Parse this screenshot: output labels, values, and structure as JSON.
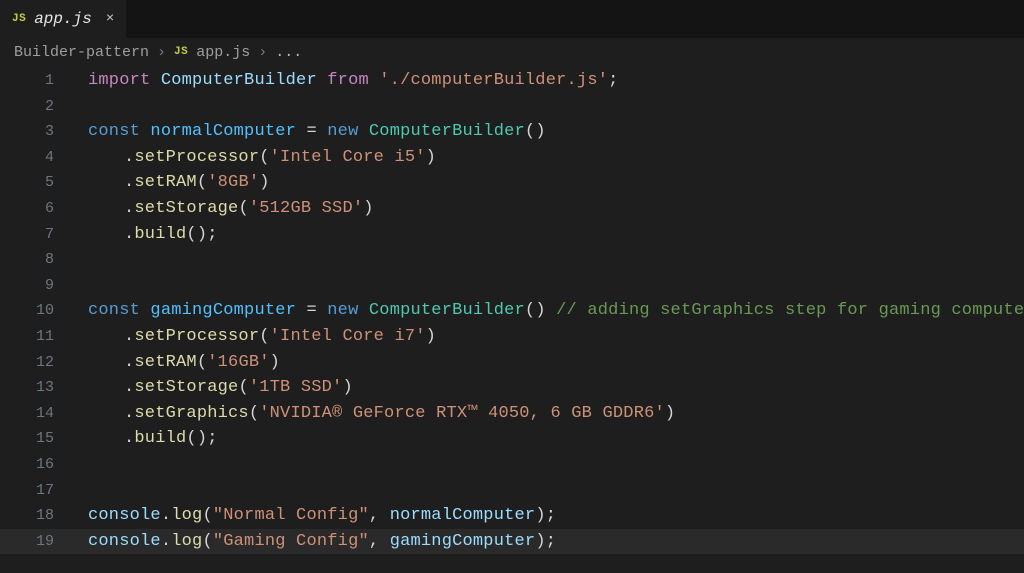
{
  "tab": {
    "lang_badge": "JS",
    "filename": "app.js",
    "close_glyph": "×"
  },
  "breadcrumb": {
    "folder": "Builder-pattern",
    "sep": "›",
    "lang_badge": "JS",
    "filename": "app.js",
    "ellipsis": "..."
  },
  "gutter": [
    "1",
    "2",
    "3",
    "4",
    "5",
    "6",
    "7",
    "8",
    "9",
    "10",
    "11",
    "12",
    "13",
    "14",
    "15",
    "16",
    "17",
    "18",
    "19"
  ],
  "tokens": {
    "import": "import",
    "from": "from",
    "const": "const",
    "new": "new",
    "ComputerBuilder": "ComputerBuilder",
    "normalComputer": "normalComputer",
    "gamingComputer": "gamingComputer",
    "setProcessor": "setProcessor",
    "setRAM": "setRAM",
    "setStorage": "setStorage",
    "setGraphics": "setGraphics",
    "build": "build",
    "console": "console",
    "log": "log"
  },
  "strings": {
    "import_path": "'./computerBuilder.js'",
    "cpu_i5": "'Intel Core i5'",
    "ram_8": "'8GB'",
    "ssd_512": "'512GB SSD'",
    "cpu_i7": "'Intel Core i7'",
    "ram_16": "'16GB'",
    "ssd_1tb": "'1TB SSD'",
    "gpu": "'NVIDIA® GeForce RTX™ 4050, 6 GB GDDR6'",
    "normal_cfg": "\"Normal Config\"",
    "gaming_cfg": "\"Gaming Config\""
  },
  "comment_line10": "// adding setGraphics step for gaming computer",
  "punct": {
    "eq": " = ",
    "semi": ";",
    "dot": ".",
    "lpar": "(",
    "rpar": ")",
    "parens": "()",
    "comma_sp": ", "
  }
}
